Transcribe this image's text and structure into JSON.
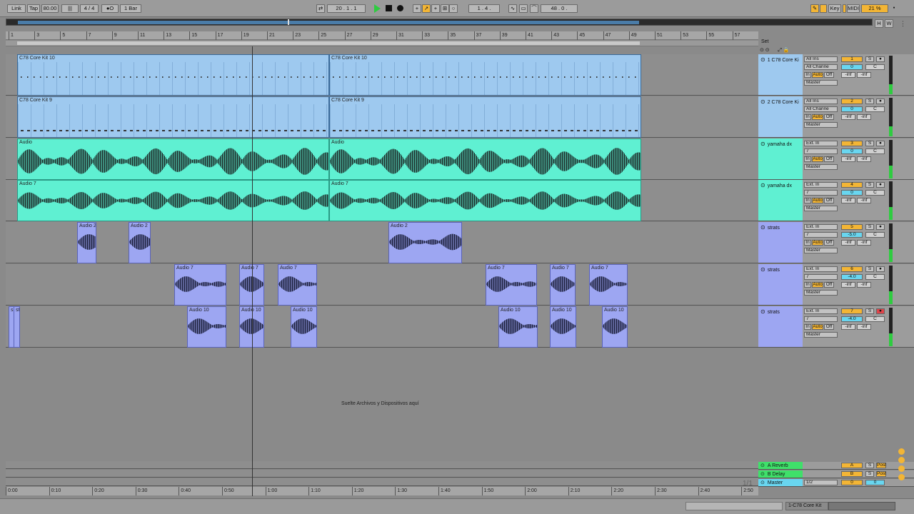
{
  "toolbar": {
    "link": "Link",
    "tap": "Tap",
    "tempo": "80.00",
    "signature": "4 / 4",
    "metro": "●O",
    "quantize": "1 Bar",
    "position": "20 .  1 .  1",
    "loop_start": "1 .  4 .",
    "loop_len": "48 .  0 .",
    "key": "Key",
    "midi": "MIDI",
    "cpu": "21 %",
    "h": "H",
    "w": "W"
  },
  "ruler": {
    "bars": [
      "1",
      "3",
      "5",
      "7",
      "9",
      "11",
      "13",
      "15",
      "17",
      "19",
      "21",
      "23",
      "25",
      "27",
      "29",
      "31",
      "33",
      "35",
      "37",
      "39",
      "41",
      "43",
      "45",
      "47",
      "49",
      "51",
      "53",
      "55",
      "57"
    ]
  },
  "time_ruler": {
    "times": [
      "0:00",
      "0:10",
      "0:20",
      "0:30",
      "0:40",
      "0:50",
      "1:00",
      "1:10",
      "1:20",
      "1:30",
      "1:40",
      "1:50",
      "2:00",
      "2:10",
      "2:20",
      "2:30",
      "2:40",
      "2:50"
    ]
  },
  "set_label": "Set",
  "drop_hint": "Suelte Archivos y Dispositivos aquí",
  "page_counter": "1/1",
  "clips": {
    "t1a": "C78 Core Kit 10",
    "t1b": "C78 Core Kit 10",
    "t2a": "C78 Core Kit 9",
    "t2b": "C78 Core Kit 9",
    "t3a": "Audio",
    "t3b": "Audio",
    "t4a": "Audio 7",
    "t4b": "Audio 7",
    "t5": [
      "Audio 2",
      "Audio 2",
      "Audio 2"
    ],
    "t6": [
      "Audio 7",
      "Audio 7",
      "Audio 7",
      "Audio 7",
      "Audio 7",
      "Audio 7"
    ],
    "t7": [
      "s",
      "st",
      "Audio 10",
      "Audio 10",
      "Audio 10",
      "Audio 10",
      "Audio 10",
      "Audio 10"
    ]
  },
  "tracks": [
    {
      "name": "1 C78 Core Ki",
      "in": "All Ins",
      "ch": "All Channe",
      "mon_in": "In",
      "mon_auto": "Auto",
      "mon_off": "Off",
      "out": "Master",
      "num": "1",
      "vol": "0",
      "pan": "C",
      "s": "S",
      "inf1": "-inf",
      "inf2": "-inf"
    },
    {
      "name": "2 C78 Core Ki",
      "in": "All Ins",
      "ch": "All Channe",
      "mon_in": "In",
      "mon_auto": "Auto",
      "mon_off": "Off",
      "out": "Master",
      "num": "2",
      "vol": "0",
      "pan": "C",
      "s": "S",
      "inf1": "-inf",
      "inf2": "-inf"
    },
    {
      "name": "yamaha dx",
      "in": "Ext. In",
      "ch": "7",
      "mon_in": "In",
      "mon_auto": "Auto",
      "mon_off": "Off",
      "out": "Master",
      "num": "3",
      "vol": "0",
      "pan": "C",
      "s": "S",
      "inf1": "-inf",
      "inf2": "-inf"
    },
    {
      "name": "yamaha dx",
      "in": "Ext. In",
      "ch": "7",
      "mon_in": "In",
      "mon_auto": "Auto",
      "mon_off": "Off",
      "out": "Master",
      "num": "4",
      "vol": "0",
      "pan": "C",
      "s": "S",
      "inf1": "-inf",
      "inf2": "-inf"
    },
    {
      "name": "strats",
      "in": "Ext. In",
      "ch": "7",
      "mon_in": "In",
      "mon_auto": "Auto",
      "mon_off": "Off",
      "out": "Master",
      "num": "5",
      "vol": "-5.0",
      "pan": "C",
      "s": "S",
      "inf1": "-inf",
      "inf2": "-inf"
    },
    {
      "name": "strats",
      "in": "Ext. In",
      "ch": "7",
      "mon_in": "In",
      "mon_auto": "Auto",
      "mon_off": "Off",
      "out": "Master",
      "num": "6",
      "vol": "-4.0",
      "pan": "C",
      "s": "S",
      "inf1": "-inf",
      "inf2": "-inf"
    },
    {
      "name": "strats",
      "in": "Ext. In",
      "ch": "7",
      "mon_in": "In",
      "mon_auto": "Auto",
      "mon_off": "Off",
      "out": "Master",
      "num": "7",
      "vol": "-4.0",
      "pan": "C",
      "s": "S",
      "inf1": "-inf",
      "inf2": "-inf"
    }
  ],
  "returns": [
    {
      "name": "A Reverb",
      "num": "A",
      "s": "S",
      "post": "Post"
    },
    {
      "name": "B Delay",
      "num": "B",
      "s": "S",
      "post": "Post"
    }
  ],
  "master": {
    "name": "Master",
    "out": "1/2",
    "num": "0",
    "vol": "0"
  },
  "status": {
    "track": "1-C78 Core Kit"
  },
  "colors": {
    "midi_clip": "#9ec9ef",
    "audio_green": "#5ff0d2",
    "audio_purple": "#9da6f2",
    "accent": "#f3b535",
    "play": "#2ecc40"
  }
}
